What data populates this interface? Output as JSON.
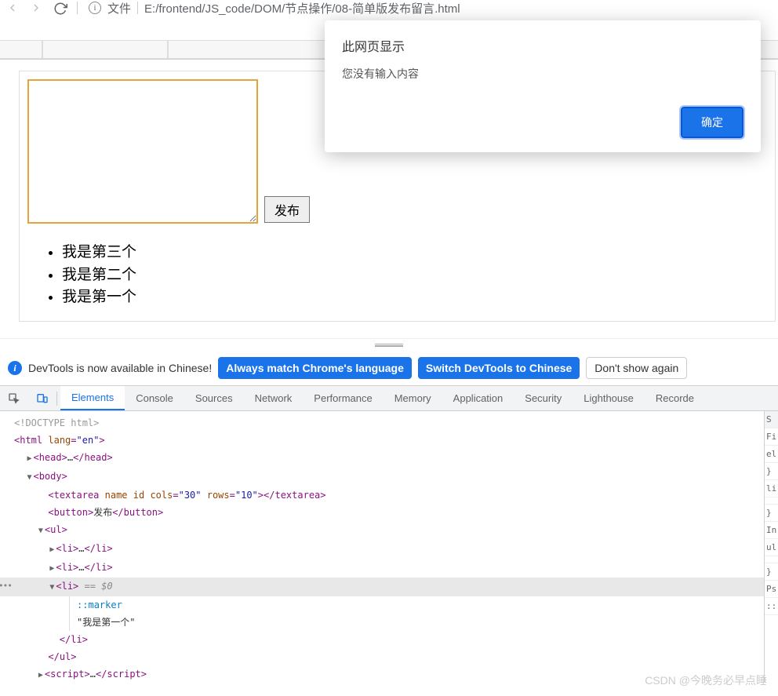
{
  "browser": {
    "file_label": "文件",
    "url": "E:/frontend/JS_code/DOM/节点操作/08-简单版发布留言.html"
  },
  "alert": {
    "title": "此网页显示",
    "message": "您没有输入内容",
    "ok": "确定"
  },
  "page": {
    "publish_btn": "发布",
    "items": [
      "我是第三个",
      "我是第二个",
      "我是第一个"
    ]
  },
  "notice": {
    "text": "DevTools is now available in Chinese!",
    "btn1": "Always match Chrome's language",
    "btn2": "Switch DevTools to Chinese",
    "btn3": "Don't show again"
  },
  "tabs": [
    "Elements",
    "Console",
    "Sources",
    "Network",
    "Performance",
    "Memory",
    "Application",
    "Security",
    "Lighthouse",
    "Recorde"
  ],
  "dom": {
    "doctype": "<!DOCTYPE html>",
    "html_open": "html",
    "html_attr_name": "lang",
    "html_attr_val": "\"en\"",
    "head": "head",
    "body": "body",
    "textarea_tag": "textarea",
    "ta_attr1": "name",
    "ta_attr2": "id",
    "ta_attr3": "cols",
    "ta_val3": "\"30\"",
    "ta_attr4": "rows",
    "ta_val4": "\"10\"",
    "button_tag": "button",
    "button_text": "发布",
    "ul": "ul",
    "li": "li",
    "selected_hint": "== $0",
    "marker": "::marker",
    "li_text": "\"我是第一个\"",
    "script": "script",
    "ellipsis": "…"
  },
  "styles": {
    "head": "S",
    "rows": [
      "Fi",
      "el",
      "}",
      "li",
      " ",
      "}",
      "In",
      "ul",
      " ",
      "}",
      "Ps",
      "::"
    ]
  },
  "watermark": "CSDN @今晚务必早点睡"
}
